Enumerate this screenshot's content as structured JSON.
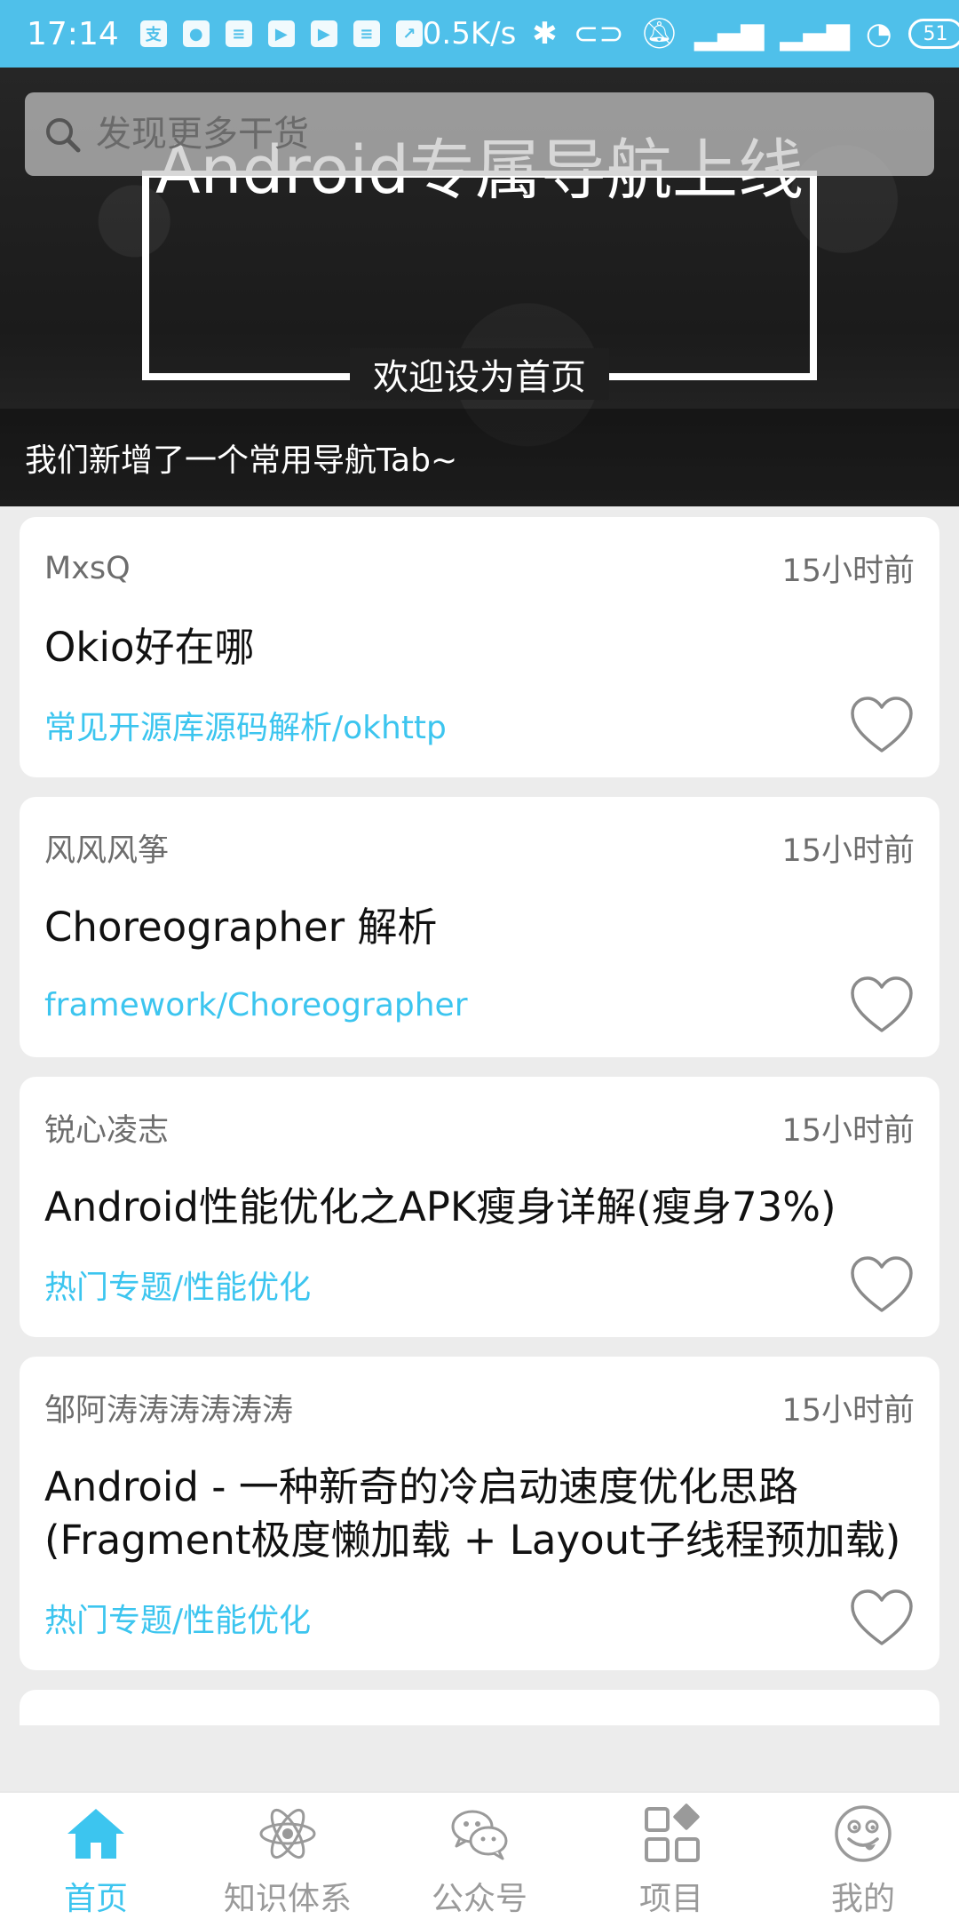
{
  "status_bar": {
    "time": "17:14",
    "network_speed": "0.5K/s",
    "battery": "51",
    "bg_color": "#4fc0ea"
  },
  "search": {
    "placeholder": "发现更多干货"
  },
  "banner": {
    "title": "Android专属导航上线",
    "subtitle": "欢迎设为首页",
    "caption": "我们新增了一个常用导航Tab~"
  },
  "articles": [
    {
      "author": "MxsQ",
      "time": "15小时前",
      "title": "Okio好在哪",
      "category": "常见开源库源码解析/okhttp",
      "favorited": false
    },
    {
      "author": "风风风筝",
      "time": "15小时前",
      "title": "Choreographer 解析",
      "category": "framework/Choreographer",
      "favorited": false
    },
    {
      "author": "锐心凌志",
      "time": "15小时前",
      "title": "Android性能优化之APK瘦身详解(瘦身73%)",
      "category": "热门专题/性能优化",
      "favorited": false
    },
    {
      "author": "邹阿涛涛涛涛涛涛",
      "time": "15小时前",
      "title": "Android - 一种新奇的冷启动速度优化思路(Fragment极度懒加载 + Layout子线程预加载)",
      "category": "热门专题/性能优化",
      "favorited": false
    }
  ],
  "bottom_nav": {
    "items": [
      {
        "label": "首页",
        "icon": "home-icon",
        "active": true
      },
      {
        "label": "知识体系",
        "icon": "atom-icon",
        "active": false
      },
      {
        "label": "公众号",
        "icon": "wechat-icon",
        "active": false
      },
      {
        "label": "项目",
        "icon": "grid-icon",
        "active": false
      },
      {
        "label": "我的",
        "icon": "smiley-icon",
        "active": false
      }
    ]
  },
  "colors": {
    "accent": "#3cc5ef",
    "inactive": "#9a9a9a"
  }
}
